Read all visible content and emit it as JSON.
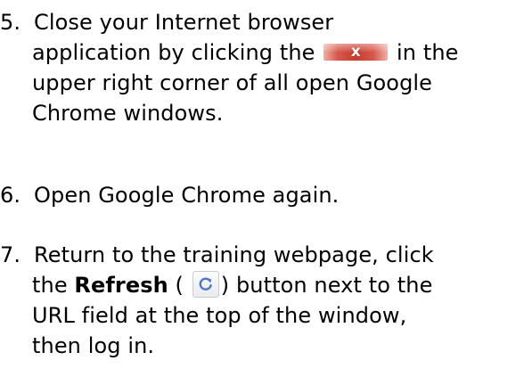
{
  "steps": [
    {
      "number": "5.",
      "lines": [
        "Close your Internet browser",
        "application by clicking the",
        "in the",
        "upper right corner of all open Google",
        "Chrome windows."
      ]
    },
    {
      "number": "6.",
      "text": "Open Google Chrome again."
    },
    {
      "number": "7.",
      "line1": "Return to the training webpage, click",
      "line2_a": "the",
      "line2_bold": "Refresh",
      "line2_b": "(",
      "line2_c": ") button next to the",
      "line3": "URL field at the top of the window,",
      "line4": "then log in."
    }
  ],
  "icons": {
    "close": "close-x-icon",
    "close_glyph": "x",
    "refresh": "refresh-icon"
  },
  "colors": {
    "close_button_red": "#c73d2e",
    "refresh_arrow": "#4a78c2"
  }
}
